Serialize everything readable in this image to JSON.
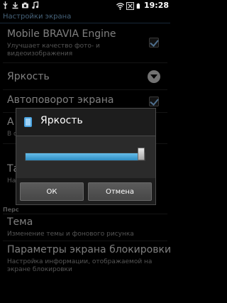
{
  "status_bar": {
    "time": "19:28",
    "left_icons": [
      "usb-icon",
      "download-icon",
      "camera-icon",
      "music-icon"
    ],
    "right_icons": [
      "wifi-icon",
      "no-signal-icon",
      "battery-icon"
    ]
  },
  "screen": {
    "title": "Настройки экрана",
    "items": [
      {
        "title": "Mobile BRAVIA Engine",
        "subtitle": "Улучшает качество фото- и видеоизображения",
        "control": "checkbox",
        "checked": true
      },
      {
        "title": "Яркость",
        "subtitle": "",
        "control": "dropdown"
      },
      {
        "title": "Автоповорот экрана",
        "subtitle": "",
        "control": "checkbox",
        "checked": true
      },
      {
        "title": "А",
        "subtitle": "В о",
        "control": "none"
      },
      {
        "title": "Та",
        "subtitle": "На",
        "control": "none"
      }
    ],
    "section_header": "Перс",
    "bottom_items": [
      {
        "title": "Тема",
        "subtitle": "Изменение темы и фонового рисунка"
      },
      {
        "title": "Параметры экрана блокировки",
        "subtitle": "Настройка информации, отображаемой на экране блокировки"
      }
    ]
  },
  "dialog": {
    "title": "Яркость",
    "brightness_level": 0.97,
    "ok_label": "ОК",
    "cancel_label": "Отмена"
  },
  "colors": {
    "accent": "#33a0dd",
    "title_text": "#7fb2dd"
  }
}
